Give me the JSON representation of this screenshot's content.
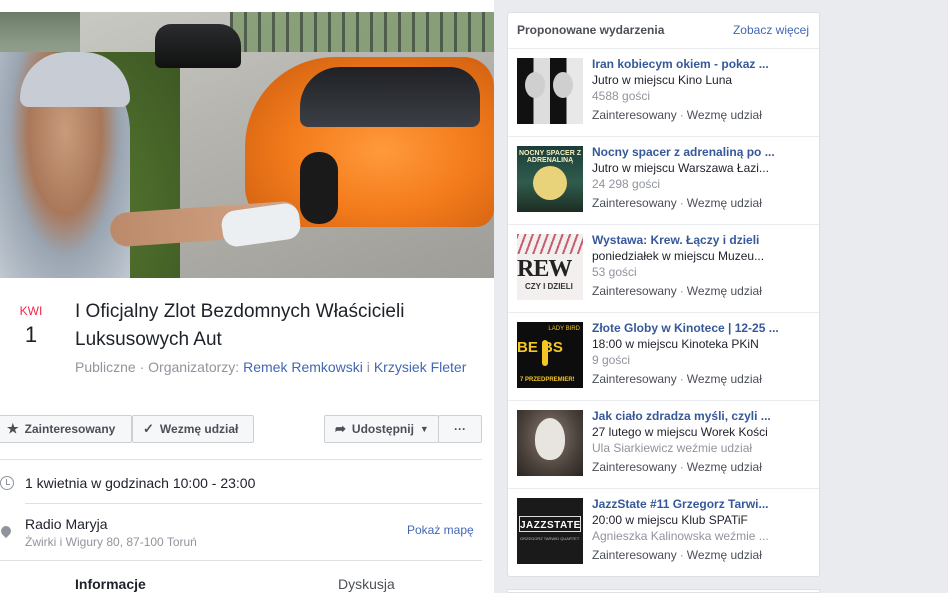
{
  "event": {
    "month": "KWI",
    "day": "1",
    "title": "I Oficjalny Zlot Bezdomnych Właścicieli Luksusowych Aut",
    "visibility": "Publiczne",
    "separator": "·",
    "organizers_label": "Organizatorzy:",
    "organizer_1": "Remek Remkowski",
    "and": "i",
    "organizer_2": "Krzysiek Fleter",
    "when": "1 kwietnia w godzinach 10:00 - 23:00",
    "place_name": "Radio Maryja",
    "place_address": "Żwirki i Wigury 80, 87-100 Toruń",
    "map_link": "Pokaż mapę"
  },
  "actions": {
    "interested": "Zainteresowany",
    "going": "Wezmę udział",
    "share": "Udostępnij",
    "more": "···"
  },
  "tabs": {
    "info": "Informacje",
    "discussion": "Dyskusja"
  },
  "suggested": {
    "heading": "Proponowane wydarzenia",
    "see_more": "Zobacz więcej",
    "action_interested": "Zainteresowany",
    "action_going": "Wezmę udział",
    "dot": "·",
    "items": [
      {
        "title": "Iran kobiecym okiem - pokaz ...",
        "when": "Jutro w miejscu Kino Luna",
        "extra": "4588 gości"
      },
      {
        "title": "Nocny spacer z adrenaliną po ...",
        "when": "Jutro w miejscu Warszawa Łazi...",
        "extra": "24 298 gości",
        "thumb_text": "NOCNY SPACER Z ADRENALINĄ"
      },
      {
        "title": "Wystawa: Krew. Łączy i dzieli",
        "when": "poniedziałek w miejscu Muzeu...",
        "extra": "53 gości",
        "thumb_big": "REW",
        "thumb_small": "CZY I DZIELI"
      },
      {
        "title": "Złote Globy w Kinotece | 12-25 ...",
        "when": "18:00 w miejscu Kinoteka PKiN",
        "extra": "9 gości",
        "thumb_top": "LADY BIRD",
        "thumb_left": "BE BS",
        "thumb_pre": "7 PRZEDPREMIER!"
      },
      {
        "title": "Jak ciało zdradza myśli, czyli ...",
        "when": "27 lutego w miejscu Worek Kości",
        "extra": "Ula Siarkiewicz weźmie udział"
      },
      {
        "title": "JazzState #11 Grzegorz Tarwi...",
        "when": "20:00 w miejscu Klub SPATiF",
        "extra": "Agnieszka Kalinowska weźmie ...",
        "thumb_label": "JAZZSTATE",
        "thumb_sub": "GRZEGORZ TARWID QUARTET"
      }
    ]
  }
}
